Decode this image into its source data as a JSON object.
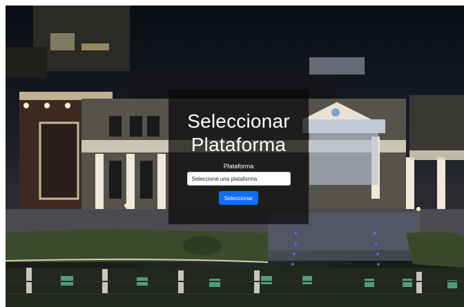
{
  "page": {
    "background_image": "night-campus-building-photo"
  },
  "form": {
    "title": "Seleccionar Plataforma",
    "field_label": "Plataforma",
    "select_value": "Seleccione una plataforma",
    "submit_label": "Seleccionar"
  },
  "colors": {
    "overlay": "#08080a",
    "button": "#0d6efd",
    "text": "#ffffff"
  }
}
